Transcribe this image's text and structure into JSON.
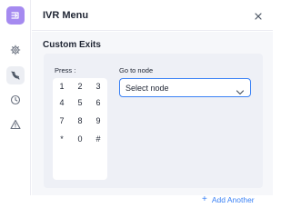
{
  "header": {
    "title": "IVR Menu"
  },
  "section": {
    "title": "Custom Exits"
  },
  "exit": {
    "press_label": "Press :",
    "goto_label": "Go to node",
    "select_value": "Select node",
    "keys": [
      "1",
      "2",
      "3",
      "4",
      "5",
      "6",
      "7",
      "8",
      "9",
      "*",
      "0",
      "#"
    ]
  },
  "actions": {
    "add_plus": "+",
    "add_label": "Add Another"
  },
  "rail": {
    "icons": [
      "flow-icon",
      "settings-icon",
      "call-off-icon",
      "clock-icon",
      "warning-icon"
    ]
  },
  "colors": {
    "accent": "#a58af0",
    "link": "#3b82f6",
    "panel": "#eef0f6"
  }
}
